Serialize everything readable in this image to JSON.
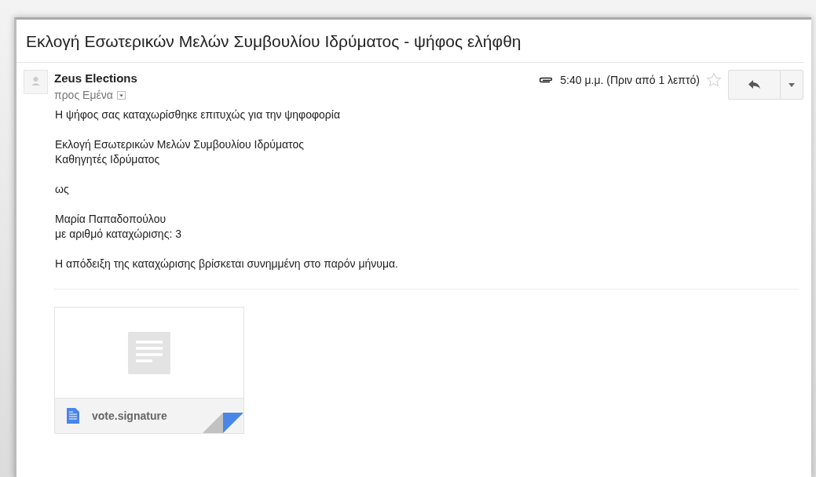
{
  "subject": "Εκλογή Εσωτερικών Μελών Συμβουλίου Ιδρύματος - ψήφος ελήφθη",
  "message": {
    "sender": "Zeus Elections",
    "recipient": "προς Εμένα",
    "has_attachment": true,
    "time": "5:40 μ.μ. (Πριν από 1 λεπτό)",
    "starred": false,
    "body": [
      [
        "Η ψήφος σας καταχωρίσθηκε επιτυχώς για την ψηφοφορία"
      ],
      [
        "Εκλογή Εσωτερικών Μελών Συμβουλίου Ιδρύματος",
        "Καθηγητές Ιδρύματος"
      ],
      [
        "ως"
      ],
      [
        "Μαρία Παπαδοπούλου",
        "με αριθμό καταχώρισης: 3"
      ],
      [
        "Η απόδειξη της καταχώρισης βρίσκεται συνημμένη στο παρόν μήνυμα."
      ]
    ],
    "attachments": [
      {
        "name": "vote.signature"
      }
    ]
  }
}
